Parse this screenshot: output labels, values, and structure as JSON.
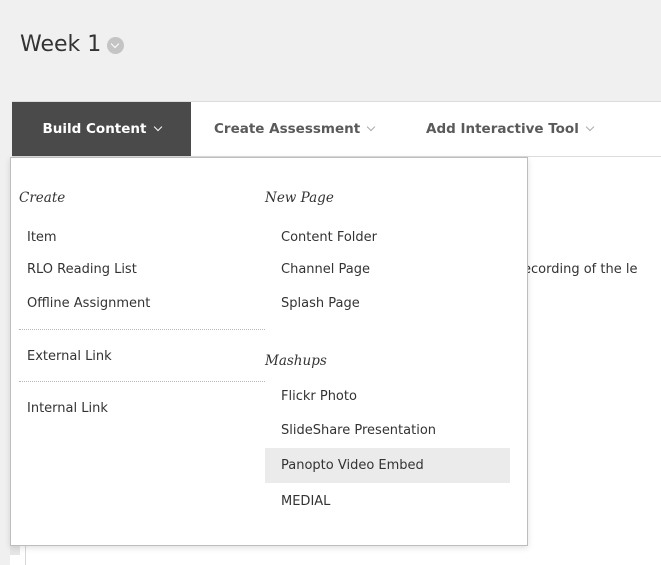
{
  "page": {
    "title": "Week 1"
  },
  "action_bar": {
    "build_content": "Build Content",
    "create_assessment": "Create Assessment",
    "add_interactive_tool": "Add Interactive Tool"
  },
  "content": {
    "partial_text": "ecording of the le"
  },
  "dropdown": {
    "create_heading": "Create",
    "create_items": [
      "Item",
      "RLO Reading List",
      "Offline Assignment"
    ],
    "external_link": "External Link",
    "internal_link": "Internal Link",
    "new_page_heading": "New Page",
    "new_page_items": [
      "Content Folder",
      "Channel Page",
      "Splash Page"
    ],
    "mashups_heading": "Mashups",
    "mashups_items": [
      "Flickr Photo",
      "SlideShare Presentation",
      "Panopto Video Embed",
      "MEDIAL"
    ],
    "highlighted_item": "Panopto Video Embed"
  },
  "colors": {
    "page_background": "#f0f0f0",
    "build_content_active": "#4a4a4a",
    "hover_highlight": "#ebebeb"
  },
  "icons": {
    "title_options": "chevron-circle-down-icon",
    "menu_caret": "chevron-down-icon"
  }
}
